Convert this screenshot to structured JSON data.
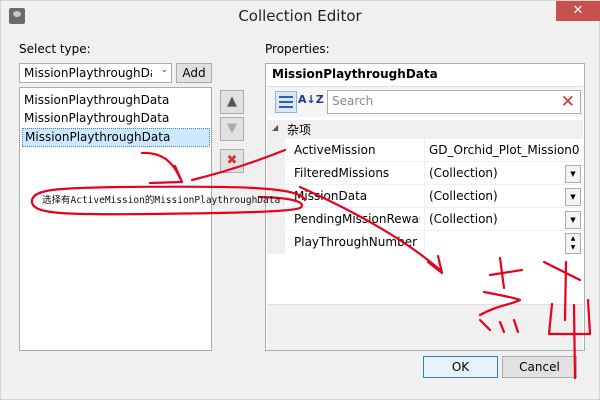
{
  "window": {
    "title": "Collection Editor",
    "close_glyph": "✕"
  },
  "left": {
    "select_type_label": "Select type:",
    "type_value": "MissionPlaythroughData",
    "add_label": "Add",
    "members": [
      {
        "label": "MissionPlaythroughData",
        "selected": false
      },
      {
        "label": "MissionPlaythroughData",
        "selected": false
      },
      {
        "label": "MissionPlaythroughData",
        "selected": true
      }
    ],
    "move_up_icon": "▲",
    "move_down_icon": "▼",
    "remove_icon": "✖"
  },
  "properties": {
    "label": "Properties:",
    "header": "MissionPlaythroughData",
    "az_sort_label": "A↓Z",
    "search_placeholder": "Search",
    "category": "杂项",
    "rows": [
      {
        "name": "ActiveMission",
        "value": "GD_Orchid_Plot_Mission0",
        "control": "none"
      },
      {
        "name": "FilteredMissions",
        "value": "(Collection)",
        "control": "dropdown"
      },
      {
        "name": "MissionData",
        "value": "(Collection)",
        "control": "dropdown"
      },
      {
        "name": "PendingMissionRewards",
        "value": "(Collection)",
        "control": "dropdown"
      },
      {
        "name": "PlayThroughNumber",
        "value": "",
        "control": "spinner"
      }
    ]
  },
  "footer": {
    "ok_label": "OK",
    "cancel_label": "Cancel"
  },
  "annotations": {
    "note": "选择有ActiveMission的MissionPlaythroughData",
    "ink_color": "#e8001c"
  }
}
